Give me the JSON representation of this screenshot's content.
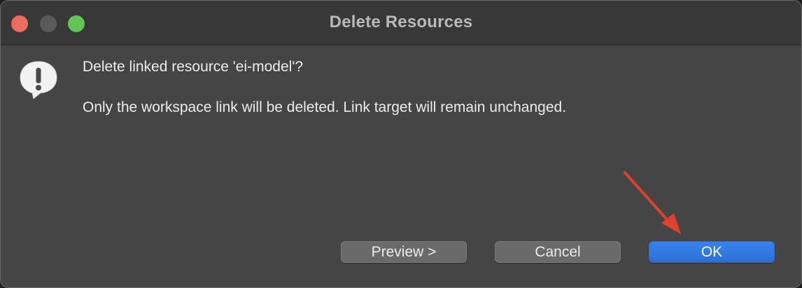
{
  "window": {
    "title": "Delete Resources"
  },
  "dialog": {
    "icon": "alert-speech-bubble-icon",
    "question": "Delete linked resource 'ei-model'?",
    "detail": "Only the workspace link will be deleted. Link target will remain unchanged."
  },
  "buttons": {
    "preview": "Preview >",
    "cancel": "Cancel",
    "ok": "OK"
  },
  "colors": {
    "accent": "#2f76e0",
    "annotation_arrow": "#e0402e",
    "close": "#ed6a5e",
    "zoom": "#61c454"
  },
  "annotation": {
    "icon": "red-arrow-pointing-to-ok"
  }
}
